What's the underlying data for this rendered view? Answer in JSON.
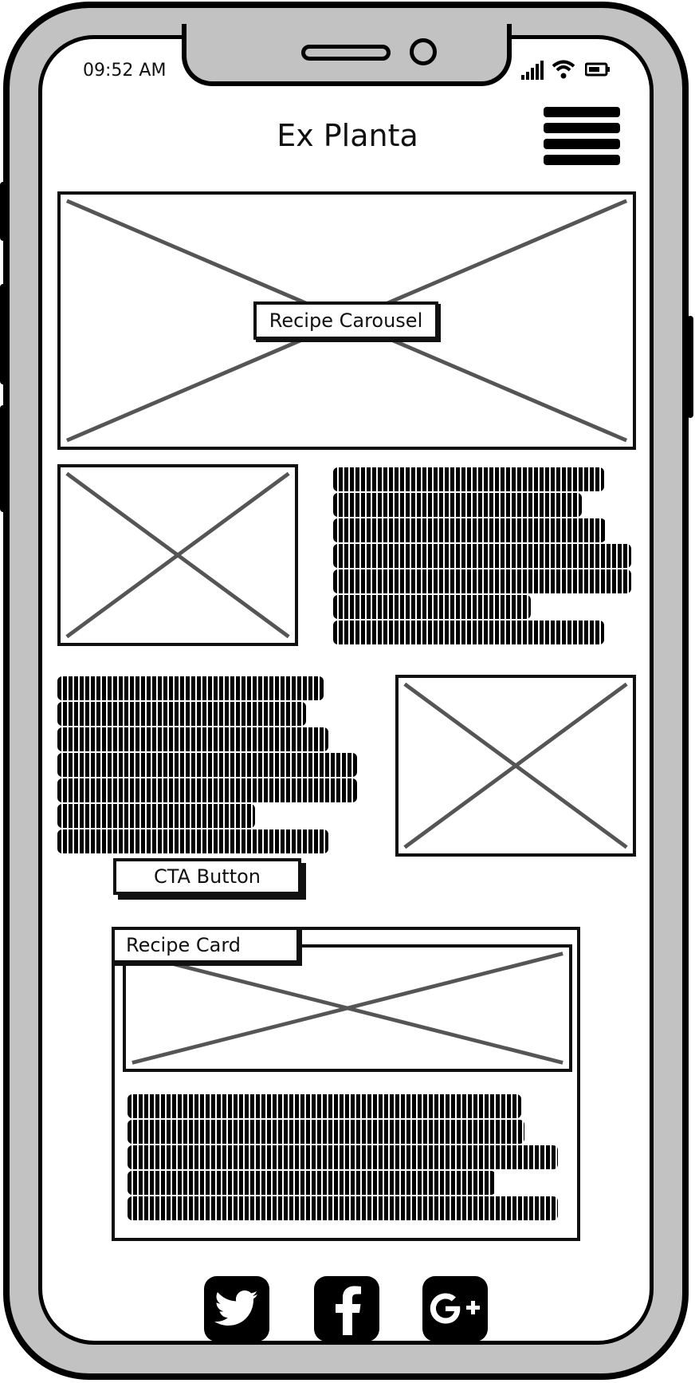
{
  "status_bar": {
    "time": "09:52 AM",
    "icons": [
      "signal-icon",
      "wifi-icon",
      "battery-icon"
    ]
  },
  "header": {
    "title": "Ex Planta",
    "menu_icon": "hamburger-menu-icon"
  },
  "carousel": {
    "label": "Recipe Carousel",
    "image_icon": "image-placeholder-icon"
  },
  "feature_one": {
    "image_icon": "image-placeholder-icon"
  },
  "feature_two": {
    "image_icon": "image-placeholder-icon"
  },
  "cta": {
    "label": "CTA Button"
  },
  "recipe_card": {
    "label": "Recipe Card",
    "image_icon": "image-placeholder-icon"
  },
  "footer": {
    "social": [
      {
        "icon": "twitter-icon"
      },
      {
        "icon": "facebook-icon"
      },
      {
        "icon": "google-plus-icon"
      }
    ]
  },
  "colors": {
    "frame": "#c2c2c2",
    "outline": "#000000",
    "placeholder_cross": "#555555"
  }
}
